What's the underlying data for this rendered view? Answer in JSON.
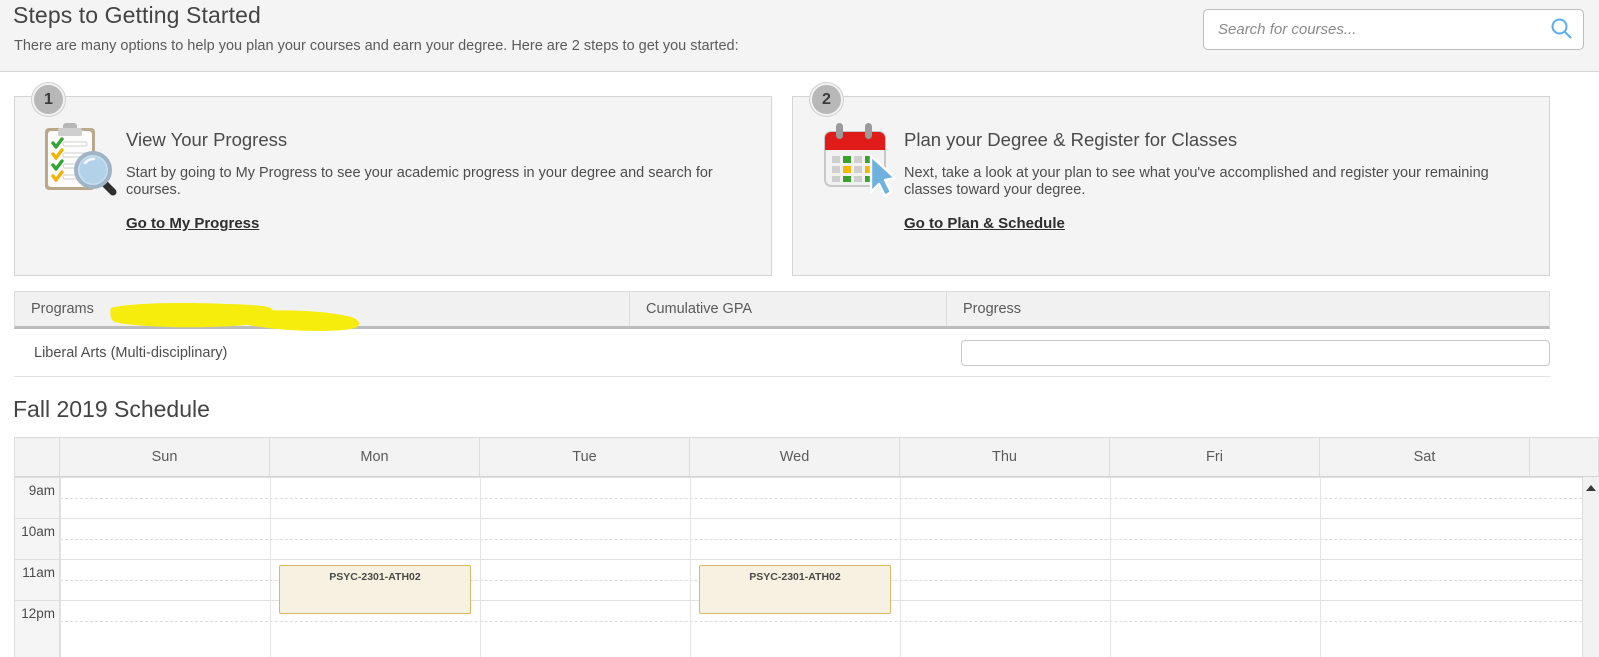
{
  "header": {
    "title": "Steps to Getting Started",
    "subtitle": "There are many options to help you plan your courses and earn your degree. Here are 2 steps to get you started:",
    "search": {
      "placeholder": "Search for courses...",
      "value": "",
      "icon": "search-icon",
      "icon_color": "#5badec"
    }
  },
  "steps": [
    {
      "number": "1",
      "icon": "clipboard-checklist-magnifier-icon",
      "heading": "View Your Progress",
      "description": "Start by going to My Progress to see your academic progress in your degree and search for courses.",
      "link_label": "Go to My Progress",
      "highlighted": true,
      "highlight_color": "#f6ed0c"
    },
    {
      "number": "2",
      "icon": "calendar-cursor-icon",
      "heading": "Plan your Degree & Register for Classes",
      "description": "Next, take a look at your plan to see what you've accomplished and register your remaining classes toward your degree.",
      "link_label": "Go to Plan & Schedule",
      "highlighted": false
    }
  ],
  "programs_table": {
    "columns": [
      "Programs",
      "Cumulative GPA",
      "Progress"
    ],
    "rows": [
      {
        "program": "Liberal Arts (Multi-disciplinary)",
        "gpa": "",
        "progress_percent": 0
      }
    ]
  },
  "schedule": {
    "title": "Fall 2019 Schedule",
    "days": [
      "Sun",
      "Mon",
      "Tue",
      "Wed",
      "Thu",
      "Fri",
      "Sat"
    ],
    "hours": [
      "9am",
      "10am",
      "11am",
      "12pm"
    ],
    "events": [
      {
        "label": "PSYC-2301-ATH02",
        "day": "Mon",
        "day_index": 1,
        "start": "11am"
      },
      {
        "label": "PSYC-2301-ATH02",
        "day": "Wed",
        "day_index": 3,
        "start": "11am"
      }
    ],
    "scrollbar": {
      "arrow": "scroll-up-arrow"
    }
  }
}
